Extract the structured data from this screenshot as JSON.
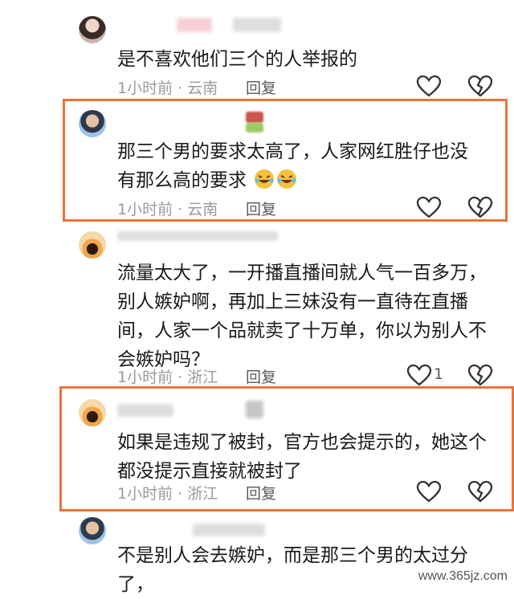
{
  "comments": [
    {
      "text": "是不喜欢他们三个的人举报的",
      "meta": "1小时前 · 云南",
      "reply": "回复",
      "like_count": ""
    },
    {
      "text_line1": "那三个男的要求太高了，人家网红胜仔也没",
      "text_line2": "有那么高的要求",
      "emoji_icon": "rofl-emoji-icon",
      "meta": "1小时前 · 云南",
      "reply": "回复",
      "like_count": ""
    },
    {
      "text": "流量太大了，一开播直播间就人气一百多万，别人嫉妒啊，再加上三妹没有一直待在直播间，人家一个品就卖了十万单，你以为别人不会嫉妒吗？",
      "meta": "1小时前 · 浙江",
      "reply": "回复",
      "like_count": "1"
    },
    {
      "text": "如果是违规了被封，官方也会提示的，她这个都没提示直接就被封了",
      "meta": "1小时前 · 浙江",
      "reply": "回复",
      "like_count": ""
    },
    {
      "text": "不是别人会去嫉妒，而是那三个男的太过分了，",
      "meta": "",
      "reply": "",
      "like_count": ""
    }
  ],
  "watermark": "www.365jz.com",
  "colors": {
    "highlight": "#e8743b",
    "meta": "#9a9a9a",
    "text": "#1a1a1a"
  },
  "icons": {
    "like": "heart-outline-icon",
    "dislike": "broken-heart-icon"
  }
}
